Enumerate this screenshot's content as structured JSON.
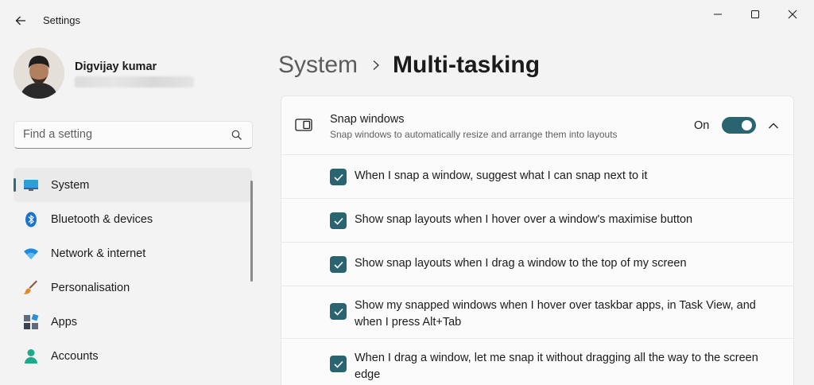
{
  "window": {
    "title": "Settings"
  },
  "profile": {
    "name": "Digvijay kumar"
  },
  "search": {
    "placeholder": "Find a setting",
    "icon": "search-icon"
  },
  "nav": {
    "items": [
      {
        "label": "System",
        "icon": "system-display-icon",
        "selected": true
      },
      {
        "label": "Bluetooth & devices",
        "icon": "bluetooth-icon",
        "selected": false
      },
      {
        "label": "Network & internet",
        "icon": "wifi-icon",
        "selected": false
      },
      {
        "label": "Personalisation",
        "icon": "paintbrush-icon",
        "selected": false
      },
      {
        "label": "Apps",
        "icon": "apps-icon",
        "selected": false
      },
      {
        "label": "Accounts",
        "icon": "person-icon",
        "selected": false
      }
    ]
  },
  "breadcrumb": {
    "parent": "System",
    "current": "Multi-tasking"
  },
  "snap": {
    "title": "Snap windows",
    "description": "Snap windows to automatically resize and arrange them into layouts",
    "toggle_state": "On",
    "toggle_on": true,
    "options": [
      {
        "label": "When I snap a window, suggest what I can snap next to it",
        "checked": true
      },
      {
        "label": "Show snap layouts when I hover over a window's maximise button",
        "checked": true
      },
      {
        "label": "Show snap layouts when I drag a window to the top of my screen",
        "checked": true
      },
      {
        "label": "Show my snapped windows when I hover over taskbar apps, in Task View, and when I press Alt+Tab",
        "checked": true
      },
      {
        "label": "When I drag a window, let me snap it without dragging all the way to the screen edge",
        "checked": true
      }
    ]
  },
  "colors": {
    "accent": "#2b6471",
    "background": "#f3f3f3",
    "card": "#fbfbfb"
  }
}
